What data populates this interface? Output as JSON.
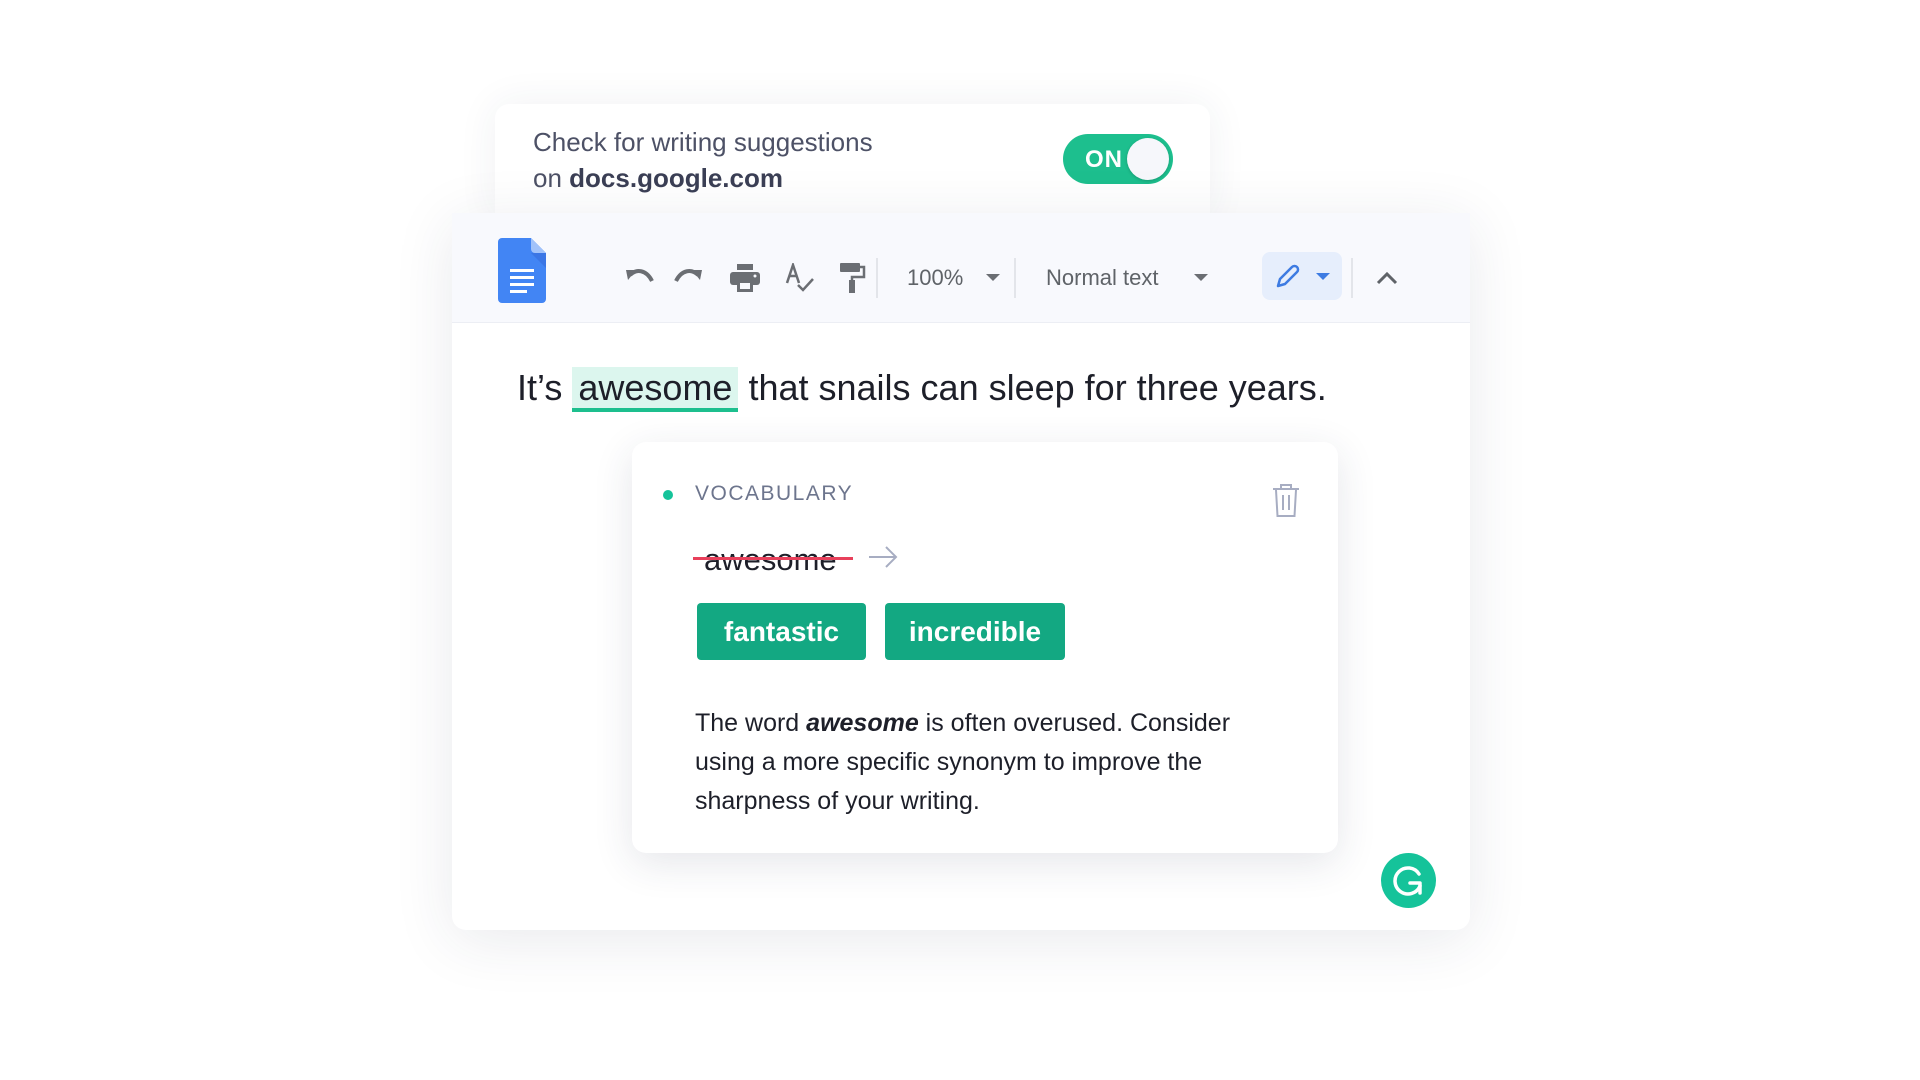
{
  "settings_card": {
    "line1": "Check for writing suggestions",
    "line2_prefix": "on ",
    "domain": "docs.google.com",
    "toggle": {
      "label": "ON",
      "state": "on",
      "color": "#1dbf8e"
    }
  },
  "toolbar": {
    "app_icon": "google-docs-icon",
    "icons": [
      "undo-icon",
      "redo-icon",
      "print-icon",
      "spellcheck-icon",
      "paint-format-icon"
    ],
    "zoom": "100%",
    "style": "Normal text",
    "mode_icon": "pencil-icon",
    "collapse_icon": "chevron-up-icon"
  },
  "document": {
    "before": "It’s",
    "highlight": "awesome",
    "after": "that snails can sleep for three years.",
    "highlight_color": "#dcf6ee",
    "underline_color": "#1dbf8e"
  },
  "suggestion": {
    "category": "VOCABULARY",
    "category_color": "#15c39a",
    "original": "awesome",
    "replacements": [
      "fantastic",
      "incredible"
    ],
    "chip_color": "#13a882",
    "explanation_prefix": "The word ",
    "explanation_bold": "awesome",
    "explanation_suffix": " is often overused. Consider using a more specific synonym to improve the sharpness of your writing."
  },
  "grammarly": {
    "icon": "grammarly-g-icon",
    "color": "#15c39a"
  }
}
